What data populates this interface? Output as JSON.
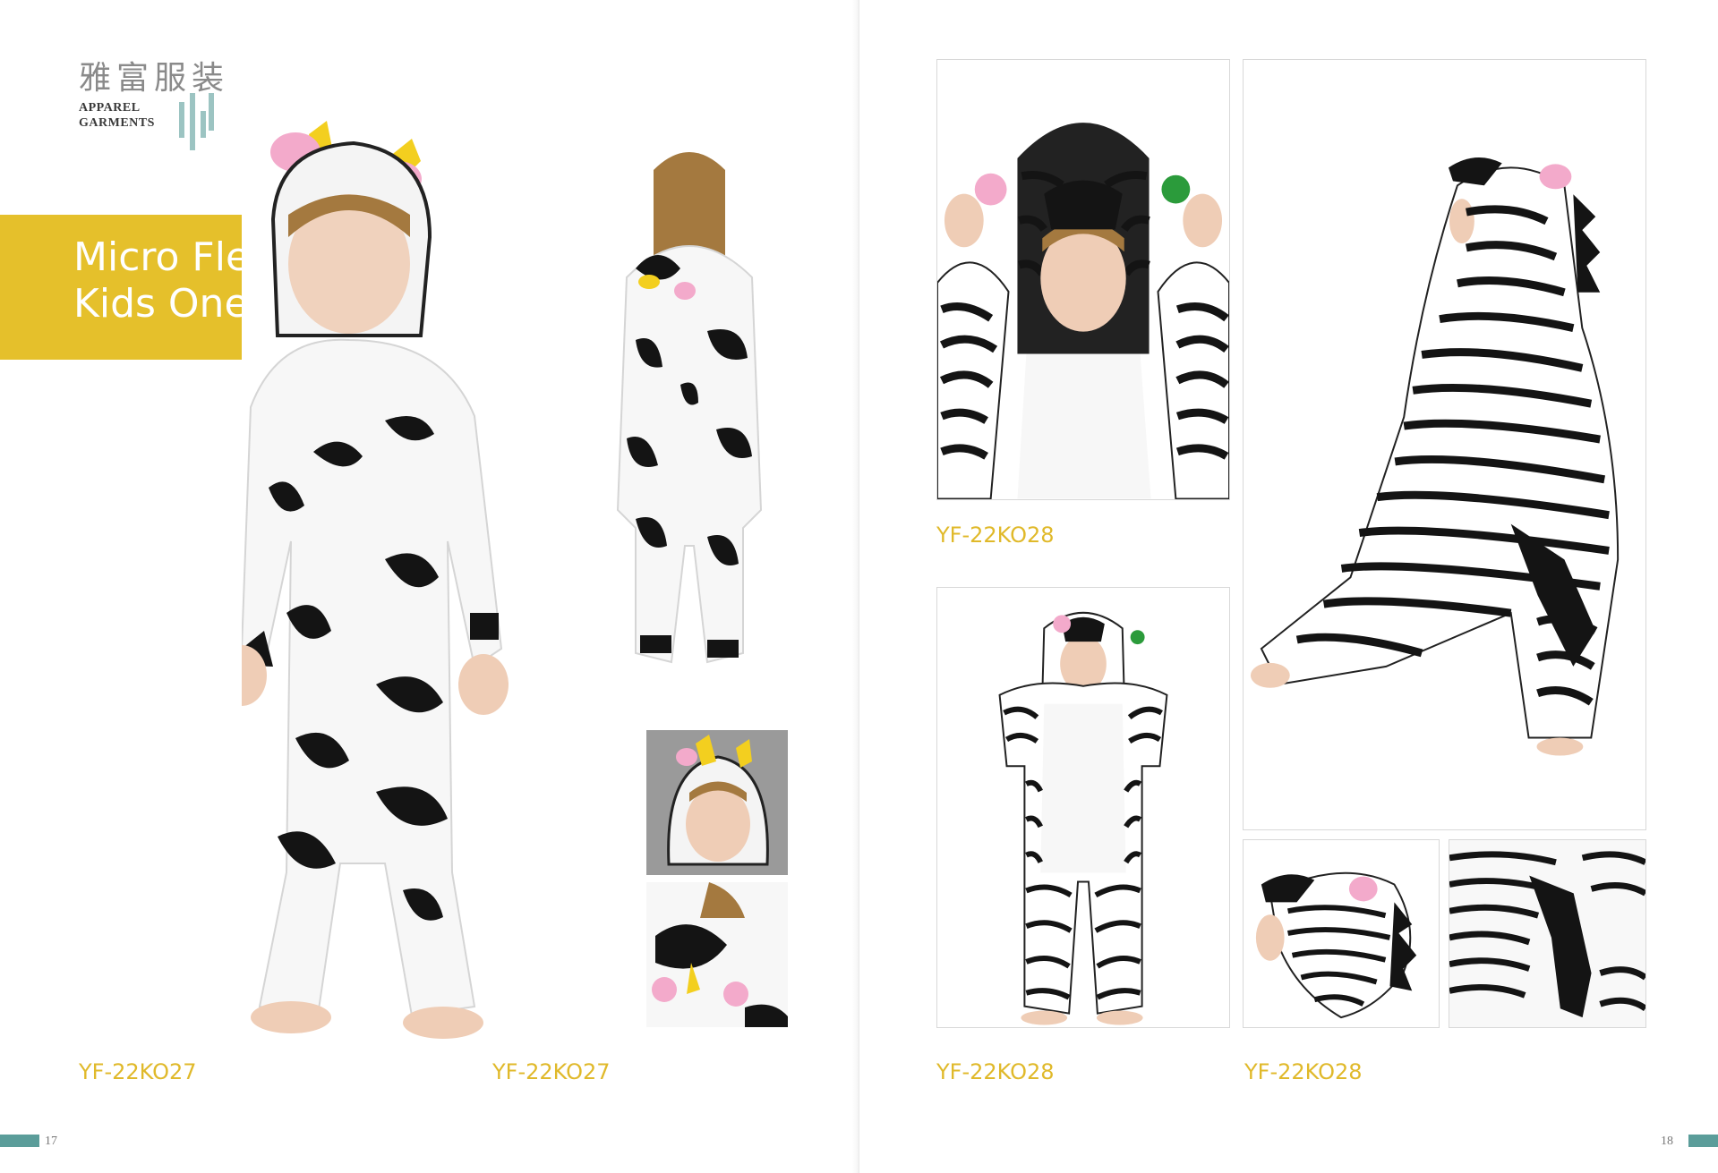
{
  "brand": {
    "name_cn": "雅富服装",
    "name_en_line1": "APPAREL",
    "name_en_line2": "GARMENTS"
  },
  "title": {
    "line1": "Micro Fleece",
    "line2": "Kids Onesie"
  },
  "left_page": {
    "codes": [
      "YF-22KO27",
      "YF-22KO27"
    ],
    "page_number": "17"
  },
  "right_page": {
    "codes": [
      "YF-22KO28",
      "YF-22KO28",
      "YF-22KO28"
    ],
    "page_number": "18"
  },
  "colors": {
    "accent_yellow": "#e5c02b",
    "code_gold": "#e0b92a",
    "teal": "#5b9d9a",
    "brand_mark": "#9cc4c2"
  }
}
